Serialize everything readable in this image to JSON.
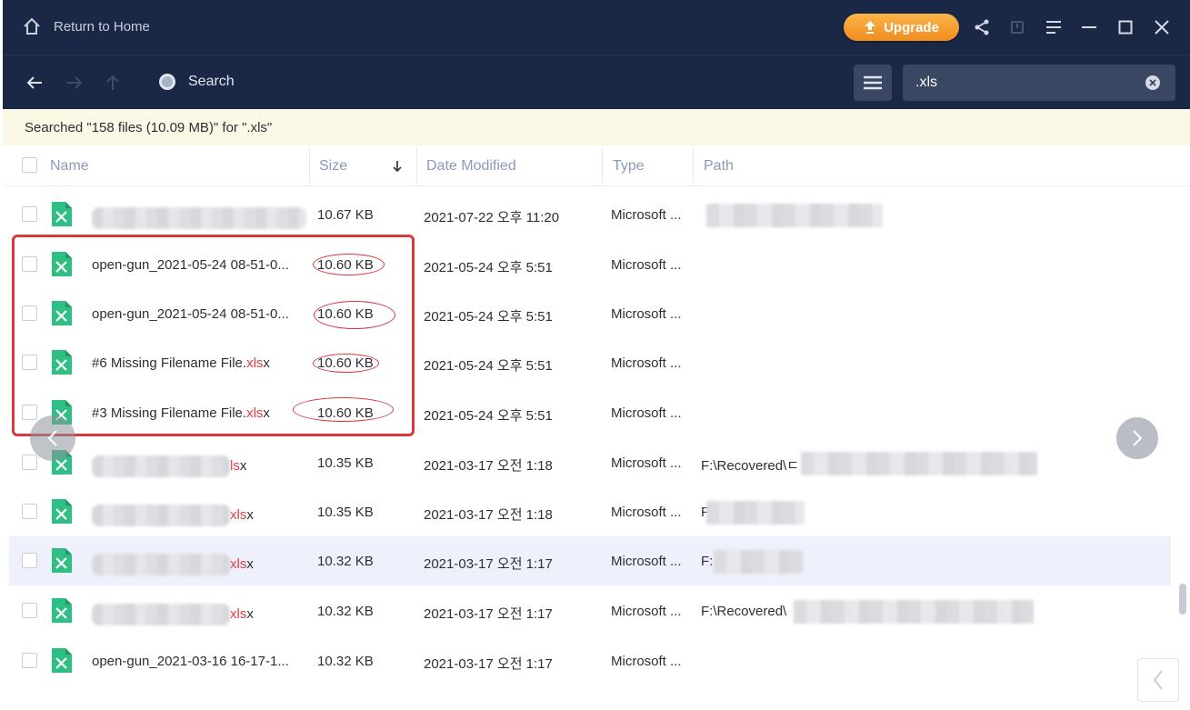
{
  "titlebar": {
    "home_label": "Return to Home",
    "upgrade_label": "Upgrade",
    "upgrade_color": "#f5a132",
    "bg_color": "#1b2845"
  },
  "toolbar": {
    "search_label": "Search",
    "search_value": ".xls"
  },
  "status": {
    "text": "Searched \"158 files (10.09 MB)\" for \".xls\""
  },
  "columns": {
    "name": "Name",
    "size": "Size",
    "date": "Date Modified",
    "type": "Type",
    "path": "Path"
  },
  "rows": [
    {
      "name": "",
      "ext": "",
      "size": "10.67 KB",
      "date": "2021-07-22 오후 11:20",
      "type": "Microsoft ...",
      "path": ""
    },
    {
      "name": "open-gun_2021-05-24 08-51-0...",
      "ext": "",
      "size": "10.60 KB",
      "date": "2021-05-24 오후 5:51",
      "type": "Microsoft ...",
      "path": ""
    },
    {
      "name": "open-gun_2021-05-24 08-51-0...",
      "ext": "",
      "size": "10.60 KB",
      "date": "2021-05-24 오후 5:51",
      "type": "Microsoft ...",
      "path": ""
    },
    {
      "name": "#6 Missing Filename File.",
      "ext": "xls",
      "ext_tail": "x",
      "size": "10.60 KB",
      "date": "2021-05-24 오후 5:51",
      "type": "Microsoft ...",
      "path": ""
    },
    {
      "name": "#3 Missing Filename File.",
      "ext": "xls",
      "ext_tail": "x",
      "size": "10.60 KB",
      "date": "2021-05-24 오후 5:51",
      "type": "Microsoft ...",
      "path": ""
    },
    {
      "name": "",
      "ext": "ls",
      "ext_tail": "x",
      "size": "10.35 KB",
      "date": "2021-03-17 오전 1:18",
      "type": "Microsoft ...",
      "path": "F:\\Recovered\\ㄷ"
    },
    {
      "name": "",
      "ext": "xls",
      "ext_tail": "x",
      "size": "10.35 KB",
      "date": "2021-03-17 오전 1:18",
      "type": "Microsoft ...",
      "path": "F"
    },
    {
      "name": "",
      "ext": "xls",
      "ext_tail": "x",
      "size": "10.32 KB",
      "date": "2021-03-17 오전 1:17",
      "type": "Microsoft ...",
      "path": "F:"
    },
    {
      "name": "",
      "ext": "xls",
      "ext_tail": "x",
      "size": "10.32 KB",
      "date": "2021-03-17 오전 1:17",
      "type": "Microsoft ...",
      "path": "F:\\Recovered\\"
    },
    {
      "name": "open-gun_2021-03-16 16-17-1...",
      "ext": "",
      "size": "10.32 KB",
      "date": "2021-03-17 오전 1:17",
      "type": "Microsoft ...",
      "path": ""
    }
  ]
}
